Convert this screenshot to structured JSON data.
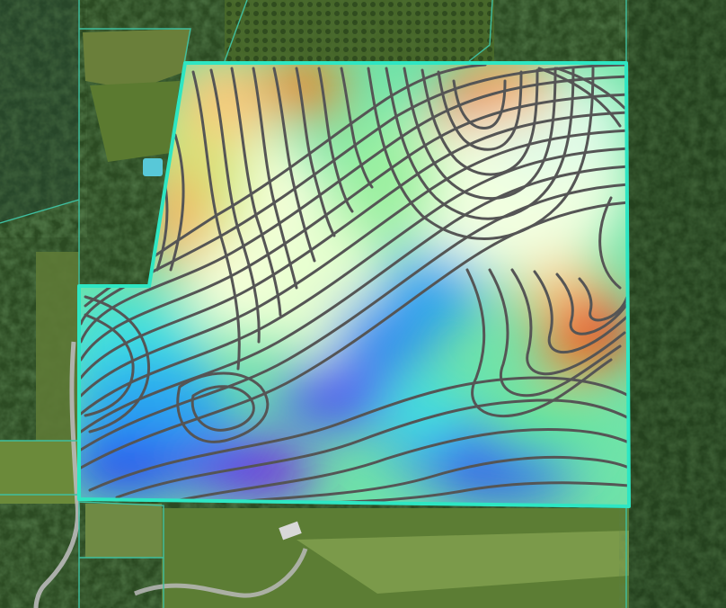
{
  "map": {
    "layers": {
      "basemap": "satellite-imagery",
      "overlay": "elevation-heatmap",
      "contours": "elevation-contour-lines",
      "boundaries": "parcel-boundaries"
    },
    "colors": {
      "boundary": "#2ee6c3",
      "parcel_line": "#3fbfa0",
      "contour": "#555555",
      "forest_dark": "#1f3a1a",
      "forest_mid": "#2e5226",
      "field": "#5e7a36",
      "road": "#b9b9b9",
      "pool": "#58c8d8",
      "elevation_ramp": [
        "#7a1fe0",
        "#2f4bf0",
        "#2aa4f0",
        "#3fe0e0",
        "#62e79a",
        "#b8f07a",
        "#ffffe0",
        "#f7c97a",
        "#f0862a",
        "#e81a1a"
      ]
    }
  }
}
